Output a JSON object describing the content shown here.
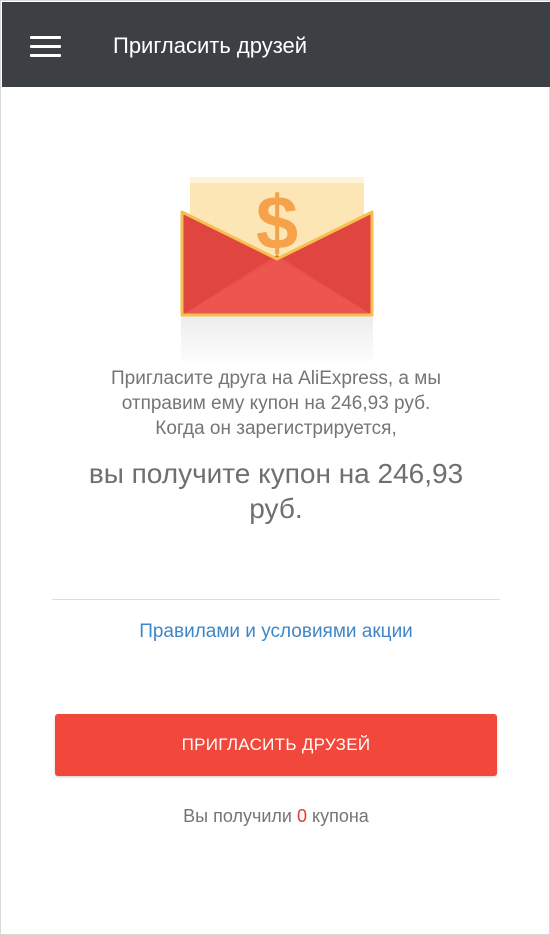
{
  "toolbar": {
    "title": "Пригласить друзей",
    "menu_icon": "hamburger-menu-icon",
    "background": "#3c3f44"
  },
  "promo": {
    "illustration_icon": "envelope-dollar-icon",
    "description_lines": [
      "Пригласите друга на AliExpress, а мы",
      "отправим ему купон на 246,93 руб.",
      "Когда он зарегистрируется,"
    ],
    "reward_lines": [
      "вы получите купон на 246,93",
      "руб."
    ]
  },
  "rules_link": "Правилами и условиями акции",
  "invite_button": {
    "label": "ПРИГЛАСИТЬ ДРУЗЕЙ",
    "color": "#f2473b"
  },
  "coupons": {
    "prefix": "Вы получили",
    "count": "0",
    "suffix": "купона"
  },
  "colors": {
    "accent_red": "#f2473b",
    "link_blue": "#3f86c8"
  }
}
